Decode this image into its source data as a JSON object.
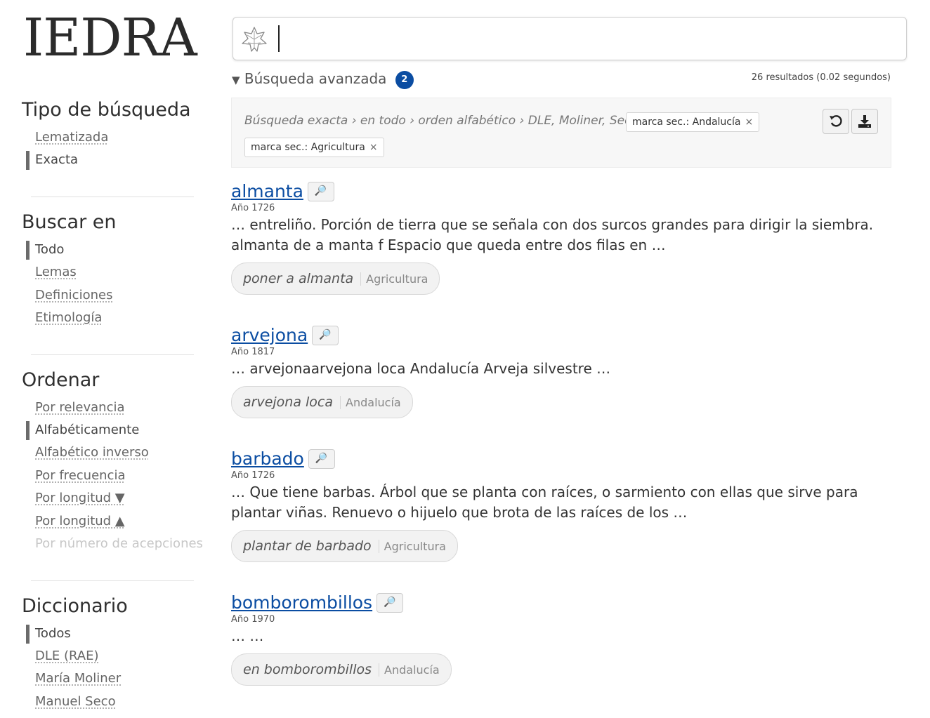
{
  "logo": "IEDRA",
  "search": {
    "value": "",
    "placeholder": ""
  },
  "advanced": {
    "label": "Búsqueda avanzada",
    "count": "2",
    "arrow": "▼"
  },
  "results_summary": "26 resultados (0.02 segundos)",
  "filters": {
    "breadcrumb": "Búsqueda exacta › en todo › orden alfabético › DLE, Moliner, Seco ›",
    "chips": [
      {
        "label": "marca sec.: Andalucía",
        "close": "×"
      },
      {
        "label": "marca sec.: Agricultura",
        "close": "×"
      }
    ],
    "reset_icon": "undo-icon",
    "download_icon": "download-icon"
  },
  "sidebar": {
    "tipo": {
      "heading": "Tipo de búsqueda",
      "items": [
        "Lematizada",
        "Exacta"
      ],
      "active": "Exacta"
    },
    "buscar": {
      "heading": "Buscar en",
      "items": [
        "Todo",
        "Lemas",
        "Definiciones",
        "Etimología"
      ],
      "active": "Todo"
    },
    "ordenar": {
      "heading": "Ordenar",
      "items": [
        "Por relevancia",
        "Alfabéticamente",
        "Alfabético inverso",
        "Por frecuencia",
        "Por longitud ▼",
        "Por longitud ▲",
        "Por número de acepciones"
      ],
      "active": "Alfabéticamente",
      "disabled": "Por número de acepciones"
    },
    "diccionario": {
      "heading": "Diccionario",
      "items": [
        "Todos",
        "DLE (RAE)",
        "María Moliner",
        "Manuel Seco"
      ],
      "active": "Todos"
    }
  },
  "results": [
    {
      "headword": "almanta",
      "year": "Año 1726",
      "snippet": "… entreliño. Porción de tierra que se señala con dos surcos grandes para dirigir la siembra. almanta de a manta f Espacio que queda entre dos filas en …",
      "phrase": "poner a almanta",
      "tag": "Agricultura"
    },
    {
      "headword": "arvejona",
      "year": "Año 1817",
      "snippet": "… arvejonaarvejona loca Andalucía Arveja silvestre …",
      "phrase": "arvejona loca",
      "tag": "Andalucía"
    },
    {
      "headword": "barbado",
      "year": "Año 1726",
      "snippet": "… Que tiene barbas. Árbol que se planta con raíces, o sarmiento con ellas que sirve para plantar viñas. Renuevo o hijuelo que brota de las raíces de los …",
      "phrase": "plantar de barbado",
      "tag": "Agricultura"
    },
    {
      "headword": "bomborombillos",
      "year": "Año 1970",
      "snippet": "… …",
      "phrase": "en bomborombillos",
      "tag": "Andalucía"
    }
  ],
  "lens_glyph": "🔎"
}
